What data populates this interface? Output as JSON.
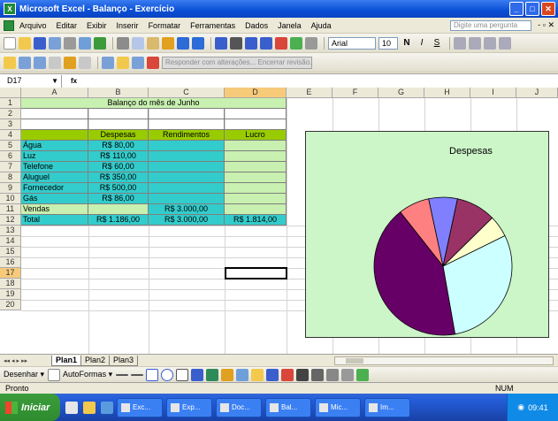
{
  "window": {
    "title": "Microsoft Excel - Balanço - Exercício",
    "app_icon": "X",
    "controls": [
      "_",
      "□",
      "✕"
    ]
  },
  "menu": {
    "items": [
      "Arquivo",
      "Editar",
      "Exibir",
      "Inserir",
      "Formatar",
      "Ferramentas",
      "Dados",
      "Janela",
      "Ajuda"
    ],
    "help_placeholder": "Digite uma pergunta",
    "right_controls": "- ▫ ✕"
  },
  "format_toolbar": {
    "font": "Arial",
    "size": "10",
    "bold": "N",
    "italic": "I",
    "underline": "S"
  },
  "review_toolbar": {
    "label": "Responder com alterações... Encerrar revisão..."
  },
  "formula_bar": {
    "name_box": "D17",
    "fx": "fx",
    "value": ""
  },
  "columns": [
    "A",
    "B",
    "C",
    "D",
    "E",
    "F",
    "G",
    "H",
    "I",
    "J"
  ],
  "rows": [
    "1",
    "2",
    "3",
    "4",
    "5",
    "6",
    "7",
    "8",
    "9",
    "10",
    "11",
    "12",
    "13",
    "14",
    "15",
    "16",
    "17",
    "18",
    "19",
    "20"
  ],
  "sheet": {
    "title": "Balanço do mês de Junho",
    "headers": {
      "b": "Despesas",
      "c": "Rendimentos",
      "d": "Lucro"
    },
    "items": [
      {
        "label": "Água",
        "despesa": "R$ 80,00"
      },
      {
        "label": "Luz",
        "despesa": "R$ 110,00"
      },
      {
        "label": "Telefone",
        "despesa": "R$ 60,00"
      },
      {
        "label": "Aluguel",
        "despesa": "R$ 350,00"
      },
      {
        "label": "Fornecedor",
        "despesa": "R$ 500,00"
      },
      {
        "label": "Gás",
        "despesa": "R$ 86,00"
      }
    ],
    "vendas": {
      "label": "Vendas",
      "rendimento": "R$ 3.000,00"
    },
    "total": {
      "label": "Total",
      "despesas": "R$ 1.186,00",
      "rendimentos": "R$ 3.000,00",
      "lucro": "R$ 1.814,00"
    }
  },
  "chart_data": {
    "type": "pie",
    "title": "Despesas",
    "categories": [
      "Água",
      "Luz",
      "Telefone",
      "Aluguel",
      "Fornecedor",
      "Gás"
    ],
    "values": [
      80,
      110,
      60,
      350,
      500,
      86
    ],
    "colors": [
      "#8080ff",
      "#993366",
      "#ffffcc",
      "#ccffff",
      "#660066",
      "#ff8080"
    ]
  },
  "sheet_tabs": [
    "Plan1",
    "Plan2",
    "Plan3"
  ],
  "active_tab": 0,
  "tab_nav": [
    "◂◂",
    "◂",
    "▸",
    "▸▸"
  ],
  "draw_toolbar": {
    "desenhar": "Desenhar ▾",
    "autoformas": "AutoFormas ▾"
  },
  "status": {
    "left": "Pronto",
    "right": "NUM"
  },
  "taskbar": {
    "start": "Iniciar",
    "buttons": [
      "Exc...",
      "Exp...",
      "Doc...",
      "Bal...",
      "Mic...",
      "Im..."
    ],
    "clock": "09:41"
  }
}
